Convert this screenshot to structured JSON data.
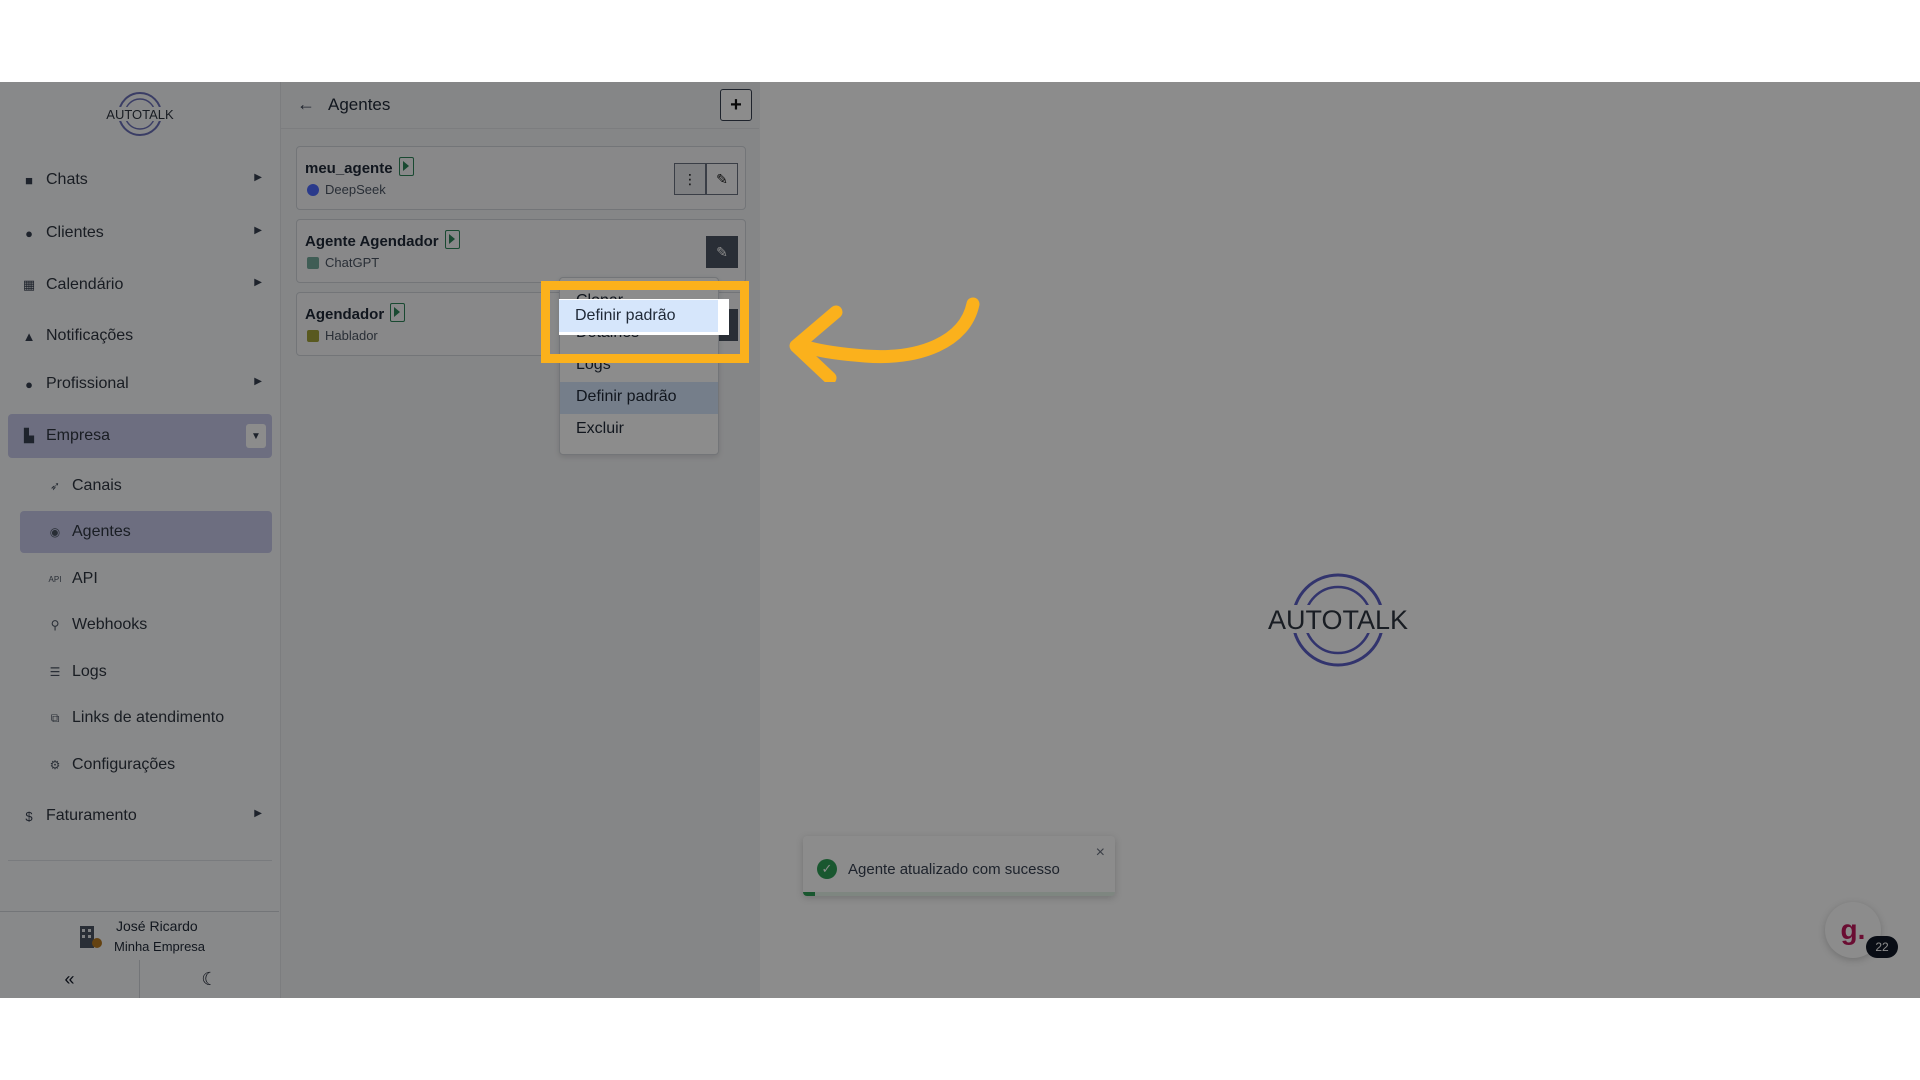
{
  "sidebar": {
    "logo_text": "AUTOTALK",
    "items": [
      {
        "label": "Chats",
        "icon": "chat-icon"
      },
      {
        "label": "Clientes",
        "icon": "users-icon"
      },
      {
        "label": "Calendário",
        "icon": "calendar-icon"
      },
      {
        "label": "Notificações",
        "icon": "bell-icon"
      },
      {
        "label": "Profissional",
        "icon": "professional-icon"
      },
      {
        "label": "Empresa",
        "icon": "building-icon"
      },
      {
        "label": "Faturamento",
        "icon": "dollar-icon"
      }
    ],
    "sub_items": [
      {
        "label": "Canais",
        "icon": "rocket-icon"
      },
      {
        "label": "Agentes",
        "icon": "robot-icon"
      },
      {
        "label": "API",
        "icon": "api-icon"
      },
      {
        "label": "Webhooks",
        "icon": "webhook-icon"
      },
      {
        "label": "Logs",
        "icon": "list-icon"
      },
      {
        "label": "Links de atendimento",
        "icon": "external-link-icon"
      },
      {
        "label": "Configurações",
        "icon": "gear-icon"
      }
    ],
    "user": {
      "name": "José Ricardo",
      "company": "Minha Empresa"
    }
  },
  "panel": {
    "title": "Agentes",
    "agents": [
      {
        "name": "meu_agente",
        "model": "DeepSeek"
      },
      {
        "name": "Agente Agendador",
        "model": "ChatGPT"
      },
      {
        "name": "Agendador",
        "model": "Hablador"
      }
    ]
  },
  "dropdown": {
    "items": [
      "Clonar",
      "Detalhes",
      "Logs",
      "Definir padrão",
      "Excluir"
    ],
    "highlighted": "Definir padrão"
  },
  "main": {
    "logo_text": "AUTOTALK"
  },
  "toast": {
    "message": "Agente atualizado com sucesso",
    "close": "×",
    "progress": 0.04
  },
  "help": {
    "letter": "g.",
    "count": "22"
  },
  "colors": {
    "accent": "#c6c9ea",
    "annotation": "#fbb11c",
    "success": "#2e9e57"
  }
}
